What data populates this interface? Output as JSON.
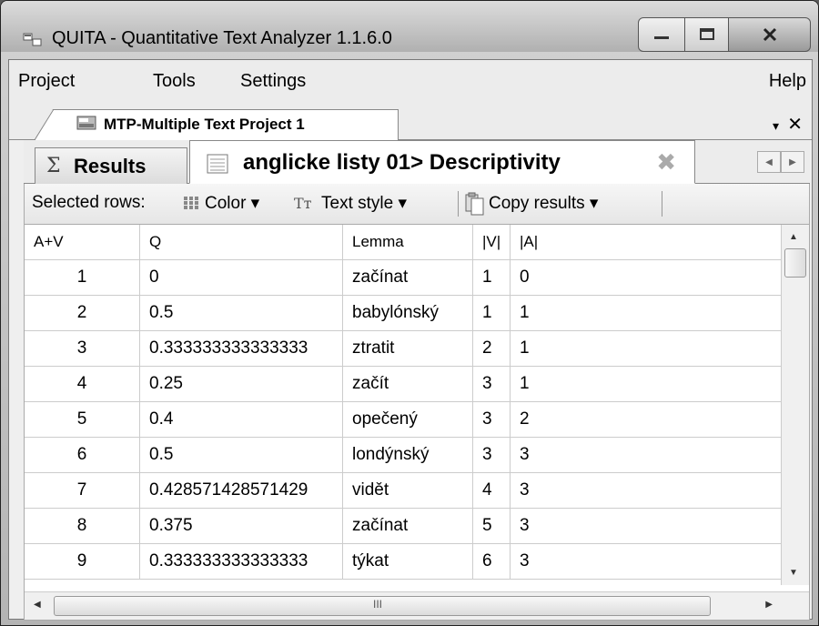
{
  "window": {
    "title": "QUITA - Quantitative Text Analyzer 1.1.6.0"
  },
  "menu": {
    "project": "Project",
    "tools": "Tools",
    "settings": "Settings",
    "help": "Help"
  },
  "doc_tab": {
    "label": "MTP-Multiple Text Project 1",
    "dropdown": "▾",
    "close": "✕"
  },
  "subtabs": {
    "results_icon": "Σ",
    "results": "Results",
    "active": "anglicke listy 01> Descriptivity",
    "active_close": "✖"
  },
  "toolbar": {
    "selected_rows": "Selected rows:",
    "color": "Color ▾",
    "text_style": "Text style ▾",
    "copy_results": "Copy results ▾"
  },
  "table": {
    "columns": [
      "A+V",
      "Q",
      "Lemma",
      "|V|",
      "|A|"
    ],
    "rows": [
      [
        "1",
        "0",
        "začínat",
        "1",
        "0"
      ],
      [
        "2",
        "0.5",
        "babylónský",
        "1",
        "1"
      ],
      [
        "3",
        "0.333333333333333",
        "ztratit",
        "2",
        "1"
      ],
      [
        "4",
        "0.25",
        "začít",
        "3",
        "1"
      ],
      [
        "5",
        "0.4",
        "opečený",
        "3",
        "2"
      ],
      [
        "6",
        "0.5",
        "londýnský",
        "3",
        "3"
      ],
      [
        "7",
        "0.428571428571429",
        "vidět",
        "4",
        "3"
      ],
      [
        "8",
        "0.375",
        "začínat",
        "5",
        "3"
      ],
      [
        "9",
        "0.333333333333333",
        "týkat",
        "6",
        "3"
      ]
    ]
  },
  "scroll": {
    "grip": "III"
  }
}
